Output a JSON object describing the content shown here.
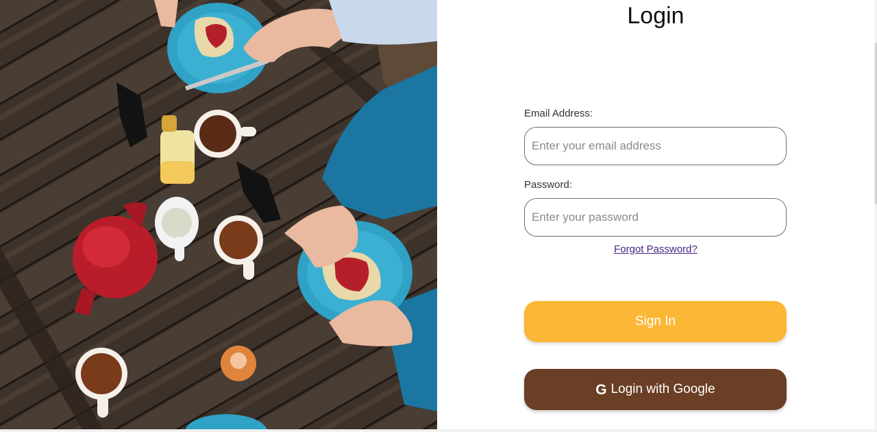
{
  "login": {
    "title": "Login",
    "email_label": "Email Address:",
    "email_placeholder": "Enter your email address",
    "email_value": "",
    "password_label": "Password:",
    "password_placeholder": "Enter your password",
    "password_value": "",
    "forgot_password": "Forgot Password?",
    "signin_label": "Sign In",
    "google_icon": "G",
    "google_label": "Login with Google"
  },
  "colors": {
    "signin_button": "#fcb736",
    "google_button": "#6a3f25",
    "link": "#4b2385"
  },
  "icons": {
    "google": "google-g-icon"
  }
}
